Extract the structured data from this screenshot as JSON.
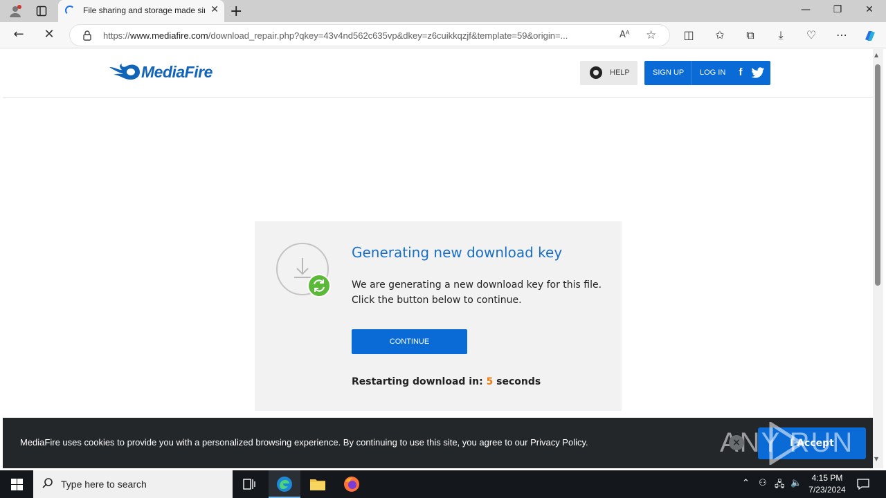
{
  "browser": {
    "tab_title": "File sharing and storage made simple",
    "url_prefix": "https://",
    "url_host": "www.mediafire.com",
    "url_path": "/download_repair.php?qkey=43v4nd562c635vp&dkey=z6cuikkqzjf&template=59&origin=...",
    "read_aloud_label": "Aᴬ"
  },
  "header": {
    "logo_text": "MediaFire",
    "help_label": "HELP",
    "signup_label": "SIGN UP",
    "login_label": "LOG IN",
    "facebook_glyph": "f"
  },
  "card": {
    "title": "Generating new download key",
    "desc_line1": "We are generating a new download key for this file.",
    "desc_line2": "Click the button below to continue.",
    "continue_label": "CONTINUE",
    "restart_prefix": "Restarting download in: ",
    "restart_count": "5",
    "restart_suffix": " seconds"
  },
  "cookie": {
    "message": "MediaFire uses cookies to provide you with a personalized browsing experience. By continuing to use this site, you agree to our Privacy Policy.",
    "accept_label": "I Accept",
    "close_glyph": "×"
  },
  "watermark": {
    "text": "ANY RUN"
  },
  "taskbar": {
    "search_placeholder": "Type here to search",
    "time": "4:15 PM",
    "date": "7/23/2024"
  },
  "colors": {
    "brand_blue": "#0a6bd6",
    "title_blue": "#1a6fc4",
    "countdown_orange": "#f07c12",
    "cookie_bg": "#24272a"
  }
}
